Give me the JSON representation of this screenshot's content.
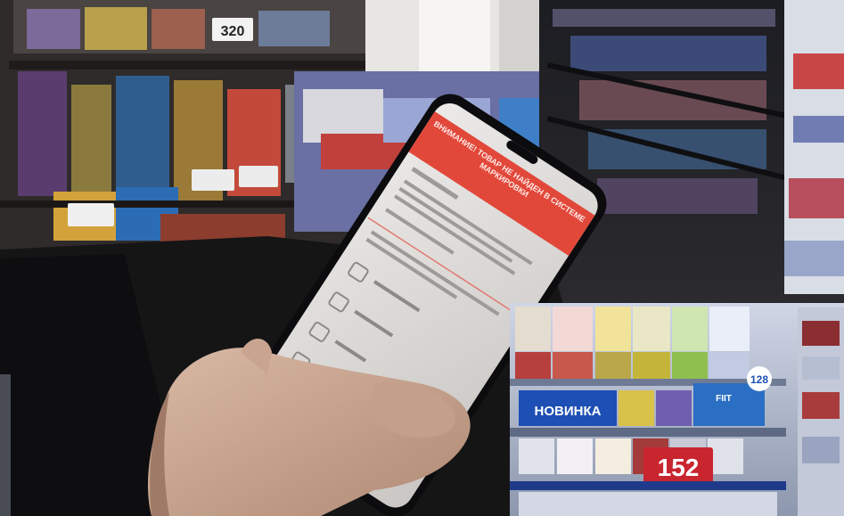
{
  "scene": {
    "shelf_price_tags": [
      "320",
      "152"
    ],
    "promo_banner": "НОВИНКА",
    "promo_sticker": "128",
    "promo_brand": "FIIT",
    "phone": {
      "alert_banner": "ВНИМАНИЕ! ТОВАР НЕ НАЙДЕН В СИСТЕМЕ МАРКИРОВКИ"
    },
    "colors": {
      "alert_red": "#e2483a",
      "promo_blue": "#1d4fb4",
      "price_tag_red": "#c8252f"
    }
  }
}
